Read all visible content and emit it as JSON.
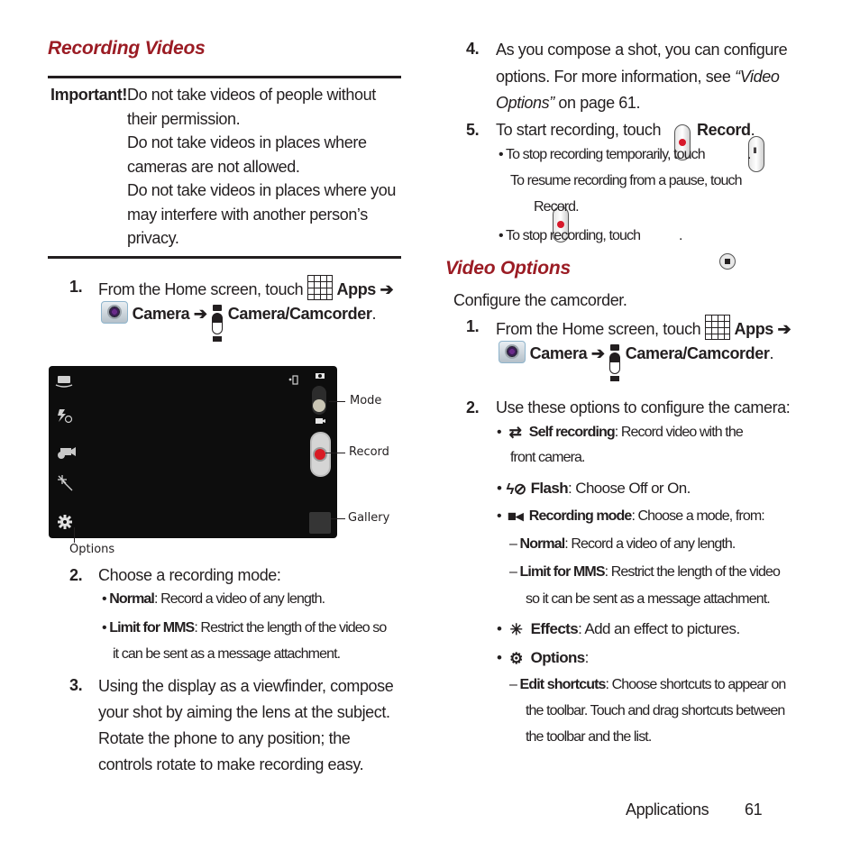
{
  "left_column": {
    "heading": "Recording Videos",
    "important": {
      "label": "Important!",
      "lines": [
        "Do not take videos of people without",
        "their permission.",
        "Do not take videos in places where",
        "cameras are not allowed.",
        "Do not take videos in places where you",
        "may interfere with another person’s",
        "privacy."
      ]
    },
    "step1": {
      "number": "1.",
      "text_before": "From the Home screen, touch",
      "apps_label": "Apps",
      "arrow": "➔",
      "camera_label": "Camera",
      "camcorder_label": "Camera/Camcorder",
      "end": "."
    },
    "viewfinder": {
      "callouts": {
        "mode": "Mode",
        "record": "Record",
        "gallery": "Gallery",
        "options": "Options"
      },
      "left_icons": [
        "self-recording-icon",
        "flash-off-icon",
        "recording-mode-icon",
        "effects-icon",
        "settings-gear-icon"
      ],
      "right_icons": [
        "rotate-icon",
        "camera-small-icon",
        "mode-toggle",
        "video-small-icon",
        "record-button",
        "gallery-thumbnail"
      ]
    },
    "step2": {
      "number": "2.",
      "text": "Choose a recording mode:",
      "bullets": [
        {
          "term": "Normal",
          "desc": ": Record a video of any length."
        },
        {
          "term": "Limit for MMS",
          "desc": ": Restrict the length of the video so",
          "desc2": "it can be sent as a message attachment."
        }
      ]
    },
    "step3": {
      "number": "3.",
      "lines": [
        "Using the display as a viewfinder, compose",
        "your shot by aiming the lens at the subject.",
        "Rotate the phone to any position; the",
        "controls rotate to make recording easy."
      ]
    }
  },
  "right_column": {
    "step4": {
      "number": "4.",
      "line1": "As you compose a shot, you can configure",
      "line2_before": "options. For more information, see ",
      "line2_link": "“Video",
      "line3_link": "Options”",
      "line3_after": " on page 61."
    },
    "step5": {
      "number": "5.",
      "text": "To start recording, touch",
      "record_label": "Record",
      "end": ".",
      "bullet1": "To stop recording temporarily, touch",
      "bullet1_cont": "To resume recording from a pause, touch",
      "bullet1_record": "Record.",
      "bullet2": "To stop recording, touch",
      "period": "."
    },
    "heading": "Video Options",
    "intro": "Configure the camcorder.",
    "step1": {
      "number": "1.",
      "text_before": "From the Home screen, touch",
      "apps_label": "Apps",
      "arrow": "➔",
      "camera_label": "Camera",
      "camcorder_label": "Camera/Camcorder",
      "end": "."
    },
    "step2": {
      "number": "2.",
      "text": "Use these options to configure the camera:",
      "options": [
        {
          "icon": "self-recording-icon",
          "glyph": "⇄",
          "term": "Self recording",
          "desc": ": Record video with the",
          "desc2": "front camera."
        },
        {
          "icon": "flash-off-icon",
          "glyph": "ϟ⊘",
          "term": "Flash",
          "desc": ": Choose Off or On."
        },
        {
          "icon": "recording-mode-icon",
          "glyph": "■◂",
          "term": "Recording mode",
          "desc": ": Choose a mode, from:"
        }
      ],
      "recording_modes": [
        {
          "term": "Normal",
          "desc": ": Record a video of any length."
        },
        {
          "term": "Limit for MMS",
          "desc": ": Restrict the length of the video",
          "desc2": "so it can be sent as a message attachment."
        }
      ],
      "more_options": [
        {
          "icon": "effects-icon",
          "glyph": "✳",
          "term": "Effects",
          "desc": ": Add an effect to pictures."
        },
        {
          "icon": "settings-gear-icon",
          "glyph": "⚙",
          "term": "Options",
          "desc": ":"
        }
      ],
      "options_sub": [
        {
          "term": "Edit shortcuts",
          "desc": ": Choose shortcuts to appear on",
          "desc2": "the toolbar. Touch and drag shortcuts between",
          "desc3": "the toolbar and the list."
        }
      ]
    }
  },
  "footer": {
    "section": "Applications",
    "page": "61"
  },
  "colors": {
    "heading": "#9b1c24",
    "text": "#231f20",
    "record_red": "#d7182a"
  }
}
